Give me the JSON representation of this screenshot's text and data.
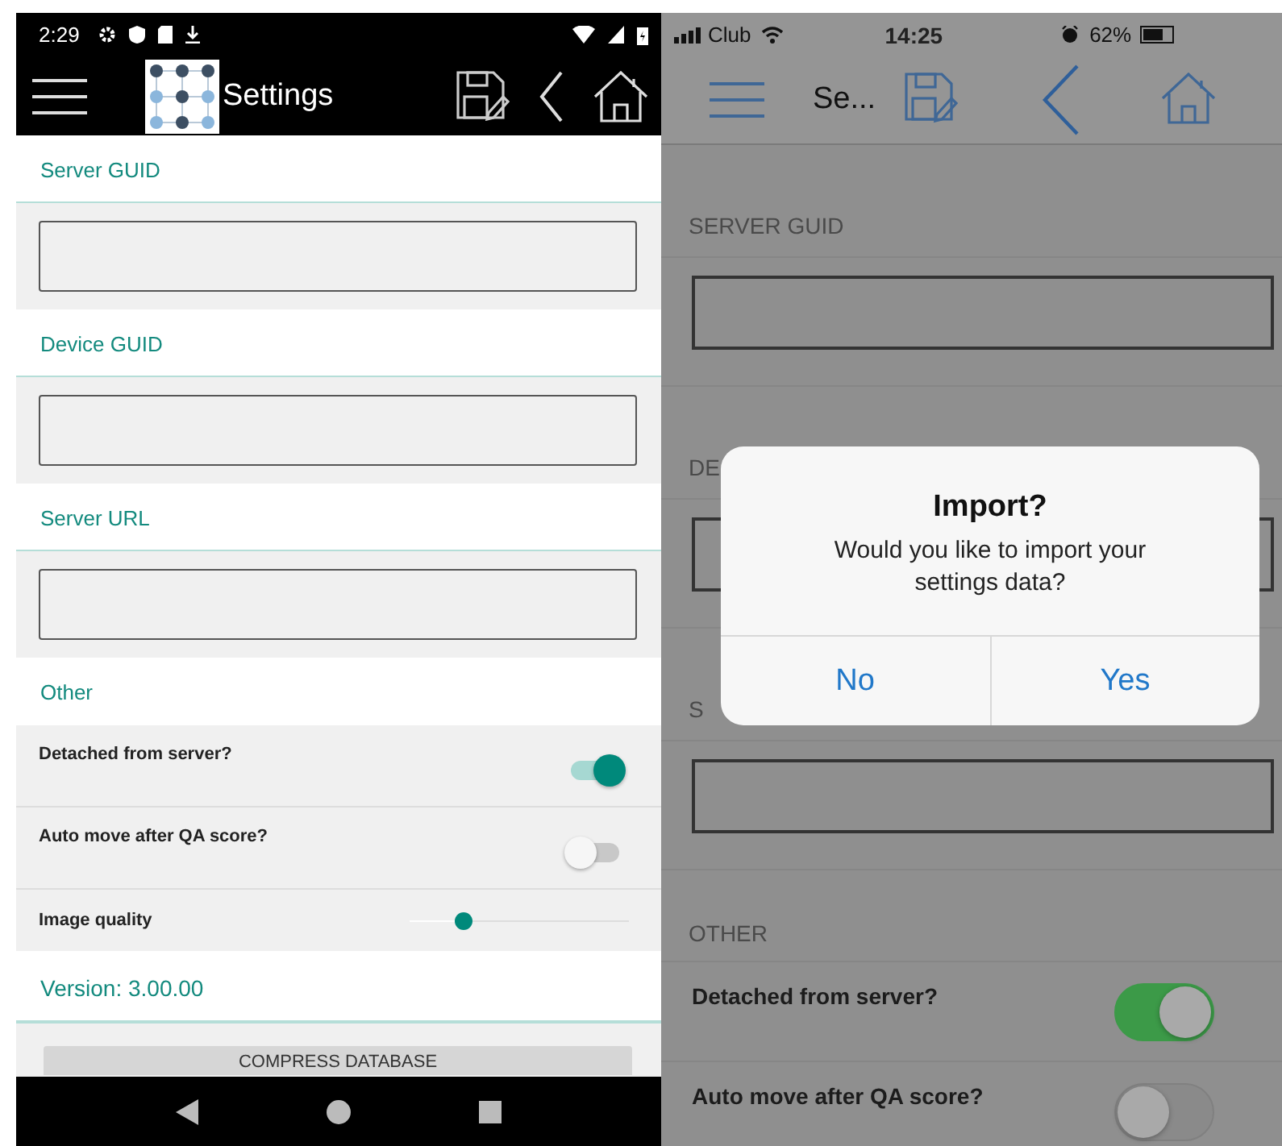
{
  "android": {
    "status_bar": {
      "time": "2:29"
    },
    "toolbar": {
      "title": "Settings"
    },
    "sections": [
      {
        "label": "Server GUID"
      },
      {
        "label": "Device GUID"
      },
      {
        "label": "Server URL"
      }
    ],
    "other": {
      "label": "Other",
      "rows": [
        {
          "kind": "toggle",
          "label": "Detached from server?",
          "on": true
        },
        {
          "kind": "toggle",
          "label": "Auto move after QA score?",
          "on": false
        },
        {
          "kind": "slider",
          "label": "Image quality",
          "level": 0.22
        }
      ]
    },
    "version": "Version: 3.00.00",
    "button": "COMPRESS DATABASE"
  },
  "ios": {
    "status_bar": {
      "carrier": "Club",
      "time": "14:25",
      "battery": "62%"
    },
    "toolbar": {
      "title": "Se..."
    },
    "sections": [
      {
        "label": "SERVER GUID"
      },
      {
        "label": "DE"
      },
      {
        "label": "S"
      }
    ],
    "other": {
      "label": "OTHER",
      "rows": [
        {
          "kind": "toggle",
          "label": "Detached from server?",
          "on": true
        },
        {
          "kind": "toggle",
          "label": "Auto move after QA score?",
          "on": false
        }
      ]
    },
    "dialog": {
      "title": "Import?",
      "message": "Would you like to import your settings data?",
      "buttons": [
        "No",
        "Yes"
      ]
    }
  }
}
